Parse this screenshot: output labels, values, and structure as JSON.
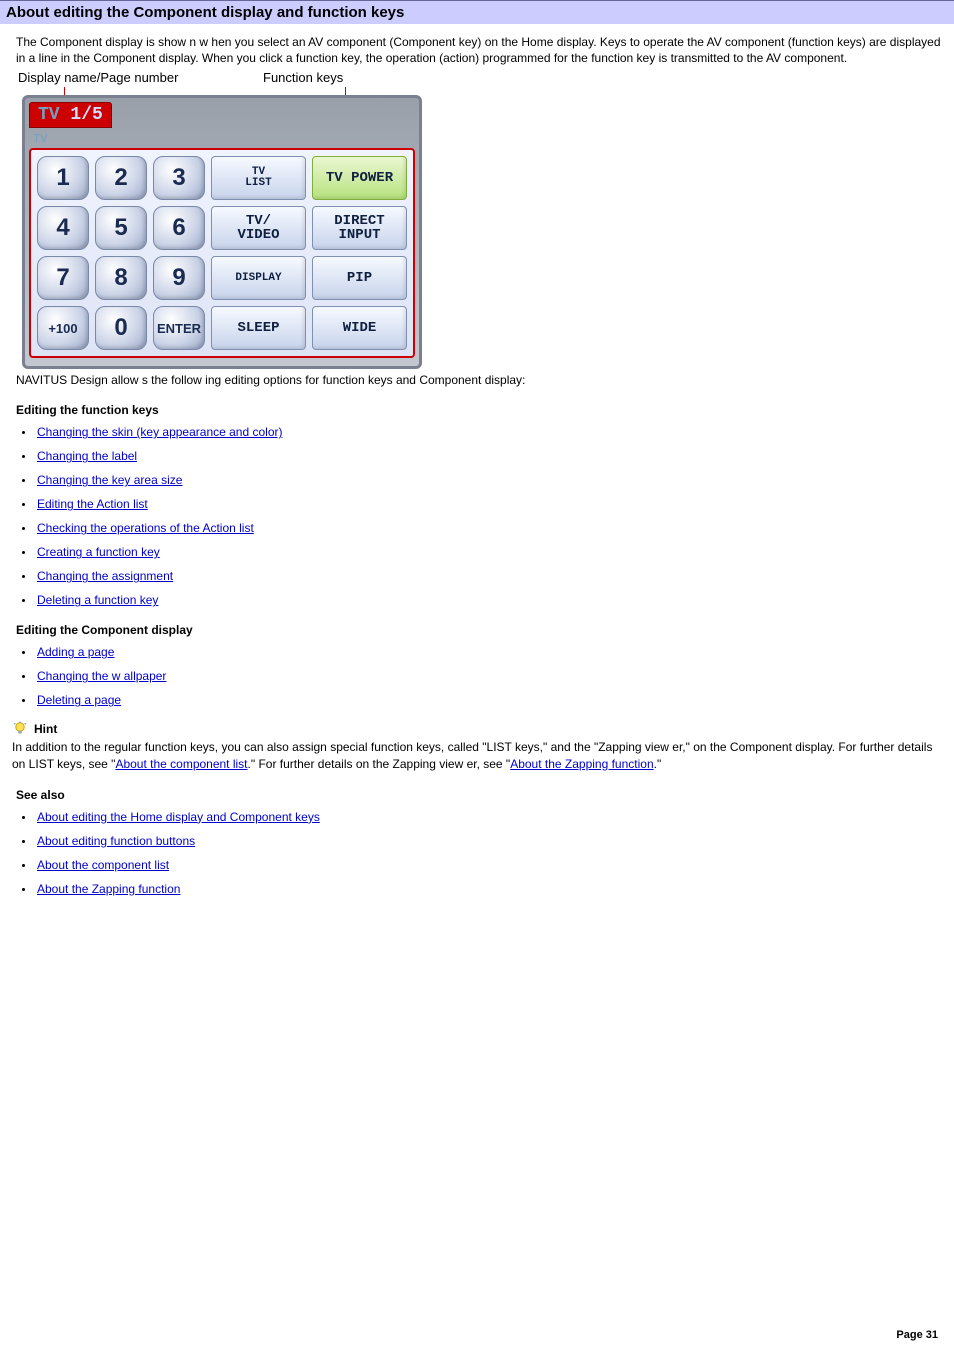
{
  "banner": {
    "title": "About editing the Component display and function keys"
  },
  "intro": "The Component display is show n w hen you select an AV component (Component key) on the Home display. Keys to operate the AV component (function keys) are displayed in a line in the Component display. When you click a function key, the operation (action) programmed for the function key is transmitted to the AV component.",
  "figure": {
    "label_display": "Display name/Page number",
    "label_function": "Function keys",
    "tab_prefix": "TV",
    "tab_page": "1/5",
    "subtab": "TV",
    "rows": [
      {
        "round": [
          "1",
          "2",
          "3"
        ],
        "square": [
          {
            "t": "TV\nLIST",
            "cls": "sml"
          },
          {
            "t": "TV POWER",
            "cls": "green"
          }
        ]
      },
      {
        "round": [
          "4",
          "5",
          "6"
        ],
        "square": [
          {
            "t": "TV/\nVIDEO",
            "cls": ""
          },
          {
            "t": "DIRECT\nINPUT",
            "cls": ""
          }
        ]
      },
      {
        "round": [
          "7",
          "8",
          "9"
        ],
        "square": [
          {
            "t": "DISPLAY",
            "cls": "sml"
          },
          {
            "t": "PIP",
            "cls": ""
          }
        ]
      },
      {
        "round": [
          "+100",
          "0",
          "ENTER"
        ],
        "square": [
          {
            "t": "SLEEP",
            "cls": ""
          },
          {
            "t": "WIDE",
            "cls": ""
          }
        ]
      }
    ]
  },
  "after_figure": "NAVITUS Design allow s the follow ing editing options for function keys and Component display:",
  "sections": {
    "editing_function_keys": {
      "title": "Editing the function keys",
      "items": [
        "Changing the skin (key appearance and color)",
        "Changing the label",
        "Changing the key area size",
        "Editing the Action list",
        "Checking the operations of the Action list",
        "Creating a function key",
        "Changing the assignment",
        "Deleting a function key"
      ]
    },
    "editing_component_display": {
      "title": "Editing the Component display",
      "items": [
        "Adding a page",
        "Changing the w allpaper",
        "Deleting a page"
      ]
    }
  },
  "hint": {
    "title": "Hint",
    "body_pre": "In addition to the regular function keys, you can also assign special function keys, called \"LIST keys,\" and the \"Zapping view er,\" on the Component display. For further details on LIST keys, see \"",
    "link1": "About the component list",
    "body_mid": ".\" For further details on the Zapping view er, see \"",
    "link2": "About the Zapping function",
    "body_post": ".\""
  },
  "see_also": {
    "title": "See also",
    "items": [
      "About editing the Home display and Component keys",
      "About editing function buttons",
      "About the component list",
      "About the Zapping function"
    ]
  },
  "page_number": "Page 31"
}
